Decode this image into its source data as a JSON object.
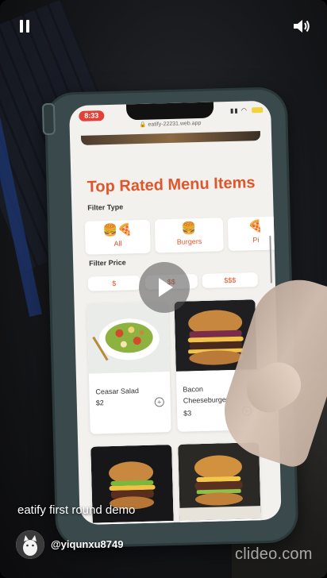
{
  "player": {
    "caption": "eatify first round demo",
    "username": "@yiqunxu8749",
    "watermark": "clideo.com",
    "icons": [
      "pause-icon",
      "volume-icon",
      "play-icon"
    ]
  },
  "phone": {
    "status_time": "8:33",
    "url": "eatify-22231.web.app"
  },
  "app": {
    "title": "Top Rated Menu Items",
    "filter_type_label": "Filter Type",
    "filter_types": [
      {
        "label": "All",
        "icon": "🍔🍕"
      },
      {
        "label": "Burgers",
        "icon": "🍔"
      },
      {
        "label": "Pi",
        "icon": "🍕"
      }
    ],
    "filter_price_label": "Filter Price",
    "prices": [
      "$",
      "$$",
      "$$$"
    ],
    "items": [
      {
        "name": "Ceasar Salad",
        "price": "$2"
      },
      {
        "name": "Bacon Cheeseburger",
        "price": "$3"
      }
    ]
  },
  "colors": {
    "accent": "#e0562b",
    "status_pill": "#e2413a"
  }
}
